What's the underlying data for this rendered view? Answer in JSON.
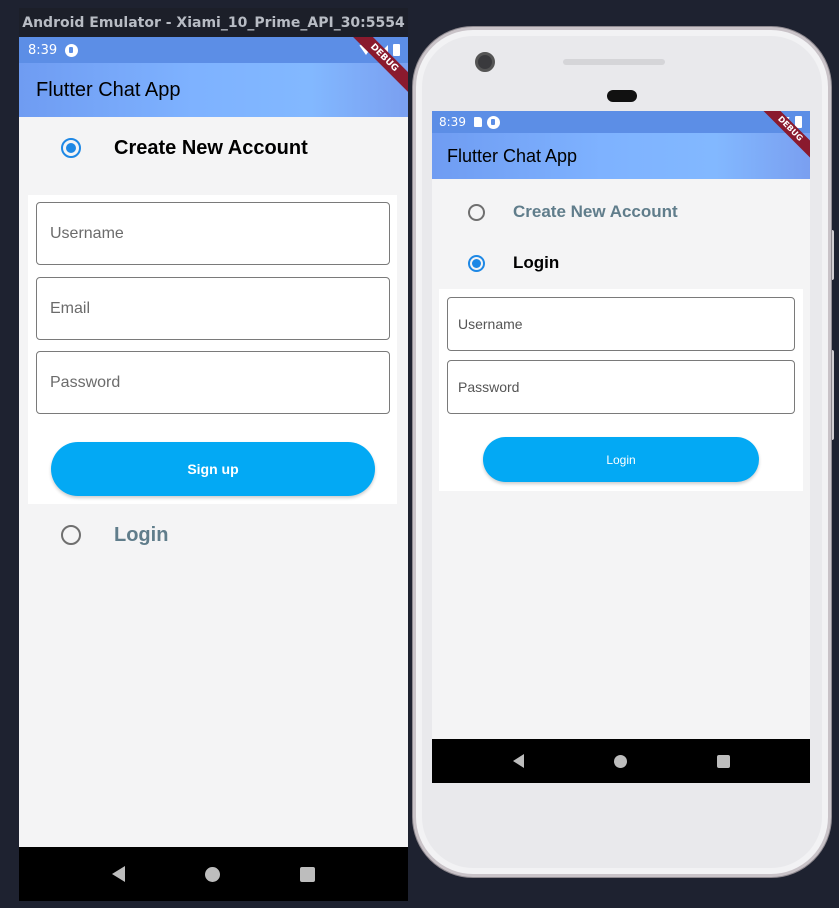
{
  "emulator": {
    "window_title": "Android Emulator - Xiami_10_Prime_API_30:5554"
  },
  "left_device": {
    "status_time": "8:39",
    "app_title": "Flutter Chat App",
    "debug_label": "DEBUG",
    "create_account_label": "Create New Account",
    "create_account_selected": true,
    "fields": {
      "username_placeholder": "Username",
      "email_placeholder": "Email",
      "password_placeholder": "Password"
    },
    "signup_button": "Sign up",
    "login_label": "Login",
    "login_selected": false
  },
  "right_device": {
    "status_time": "8:39",
    "app_title": "Flutter Chat App",
    "debug_label": "DEBUG",
    "create_account_label": "Create New Account",
    "create_account_selected": false,
    "login_label": "Login",
    "login_selected": true,
    "fields": {
      "username_placeholder": "Username",
      "password_placeholder": "Password"
    },
    "login_button": "Login"
  },
  "colors": {
    "accent": "#1e88e5",
    "button": "#03a9f4",
    "inactive_label": "#607d8b",
    "debug_banner": "#8a1a2e",
    "status_bar": "#5c8ee6"
  },
  "icons": [
    "fvm-status-icon",
    "sd-card-icon",
    "wifi-icon",
    "signal-icon",
    "battery-icon",
    "nav-back-icon",
    "nav-home-icon",
    "nav-recent-icon",
    "camera-icon"
  ]
}
